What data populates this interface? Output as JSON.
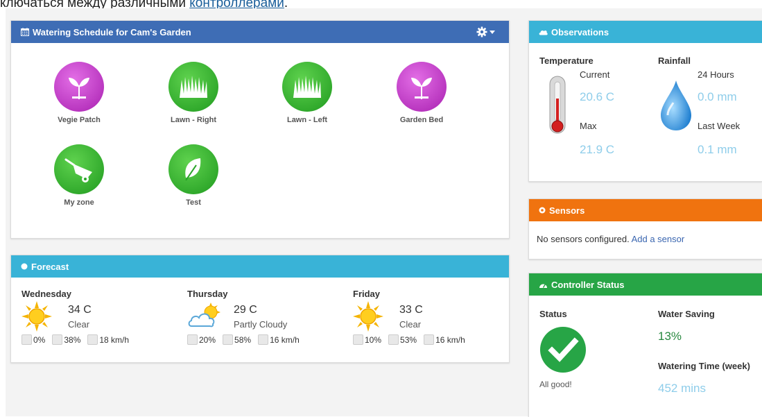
{
  "header_text": {
    "prefix": "ключаться между различными ",
    "link": "контроллерами",
    "suffix": "."
  },
  "schedule": {
    "title": "Watering Schedule for Cam's Garden",
    "zones": [
      {
        "label": "Vegie Patch",
        "icon": "sprout-icon",
        "color": "#c23ec8"
      },
      {
        "label": "Lawn - Right",
        "icon": "grass-icon",
        "color": "#3db535"
      },
      {
        "label": "Lawn - Left",
        "icon": "grass-icon",
        "color": "#3db535"
      },
      {
        "label": "Garden Bed",
        "icon": "sprout-icon",
        "color": "#c23ec8"
      },
      {
        "label": "My zone",
        "icon": "wheelbarrow-icon",
        "color": "#3db535"
      },
      {
        "label": "Test",
        "icon": "leaf-icon",
        "color": "#3db535"
      }
    ]
  },
  "forecast": {
    "title": "Forecast",
    "days": [
      {
        "name": "Wednesday",
        "temp": "34 C",
        "cond": "Clear",
        "icon": "sun-icon",
        "rain": "0%",
        "humidity": "38%",
        "wind": "18 km/h"
      },
      {
        "name": "Thursday",
        "temp": "29 C",
        "cond": "Partly Cloudy",
        "icon": "partly-cloudy-icon",
        "rain": "20%",
        "humidity": "58%",
        "wind": "16 km/h"
      },
      {
        "name": "Friday",
        "temp": "33 C",
        "cond": "Clear",
        "icon": "sun-icon",
        "rain": "10%",
        "humidity": "53%",
        "wind": "16 km/h"
      }
    ]
  },
  "observations": {
    "title": "Observations",
    "temperature": {
      "label": "Temperature",
      "current_label": "Current",
      "current": "20.6 C",
      "max_label": "Max",
      "max": "21.9 C"
    },
    "rainfall": {
      "label": "Rainfall",
      "h24_label": "24 Hours",
      "h24": "0.0 mm",
      "week_label": "Last Week",
      "week": "0.1 mm"
    }
  },
  "sensors": {
    "title": "Sensors",
    "text": "No sensors configured.",
    "link": "Add a sensor"
  },
  "controller": {
    "title": "Controller Status",
    "status_label": "Status",
    "status_text": "All good!",
    "saving_label": "Water Saving",
    "saving": "13%",
    "time_label": "Watering Time (week)",
    "time": "452 mins"
  },
  "colors": {
    "primary": "#3e6db5",
    "info": "#39b3d7",
    "warning": "#f0730f",
    "success": "#27a546",
    "muted_value": "#8ecdea"
  }
}
